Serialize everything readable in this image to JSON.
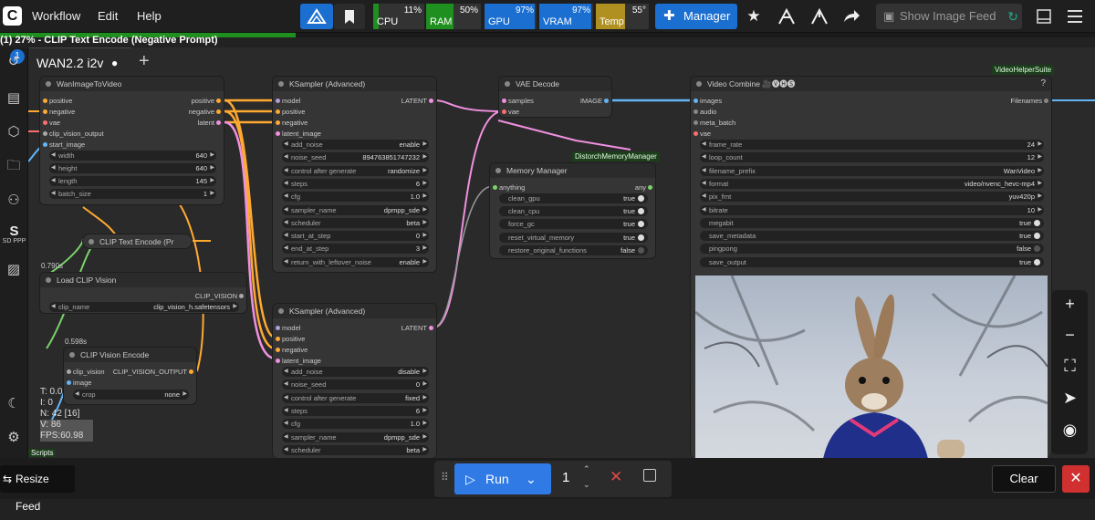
{
  "app": {
    "logo_text": "C"
  },
  "menu": {
    "workflow": "Workflow",
    "edit": "Edit",
    "help": "Help"
  },
  "monitors": {
    "cpu": {
      "label": "CPU",
      "value": "11%",
      "level": 0.11,
      "color": "#1f8f1f"
    },
    "ram": {
      "label": "RAM",
      "value": "50%",
      "level": 0.5,
      "color": "#1f8f1f"
    },
    "gpu": {
      "label": "GPU",
      "value": "97%",
      "level": 0.97,
      "color": "#1a6fd1"
    },
    "vram": {
      "label": "VRAM",
      "value": "97%",
      "level": 0.97,
      "color": "#1a6fd1"
    },
    "temp": {
      "label": "Temp",
      "value": "55°",
      "level": 0.55,
      "color": "#b09020"
    }
  },
  "toolbar": {
    "manager": "Manager",
    "show_image_feed": "Show Image Feed"
  },
  "progress": {
    "status": "(1) 27% - CLIP Text Encode (Negative Prompt)",
    "fraction": 0.27
  },
  "tab": {
    "name": "WAN2.2 i2v",
    "modified": "●",
    "add": "+",
    "queue_badge": "1"
  },
  "sidebar": {
    "sd_label": "SD PPP"
  },
  "stats": {
    "t": "T: 0.0",
    "i": "I: 0",
    "n": "N: 42 [16]",
    "v": "V: 86",
    "fps": "FPS:60.98",
    "scripts": "Scripts"
  },
  "groups": {
    "vhs": "VideoHelperSuite",
    "distorch": "DistorchMemoryManager"
  },
  "nodes": {
    "wan": {
      "title": "WanImageToVideo",
      "inputs": [
        "positive",
        "negative",
        "vae",
        "clip_vision_output",
        "start_image"
      ],
      "outputs": [
        "positive",
        "negative",
        "latent"
      ],
      "widgets": [
        {
          "k": "width",
          "v": "640"
        },
        {
          "k": "height",
          "v": "640"
        },
        {
          "k": "length",
          "v": "145"
        },
        {
          "k": "batch_size",
          "v": "1"
        }
      ]
    },
    "clip_text": {
      "title": "CLIP Text Encode (Pr"
    },
    "load_clip_vision": {
      "title": "Load CLIP Vision",
      "time": "0.790s",
      "output": "CLIP_VISION",
      "widget": {
        "k": "clip_name",
        "v": "clip_vision_h.safetensors"
      }
    },
    "clip_vision_encode": {
      "title": "CLIP Vision Encode",
      "time": "0.598s",
      "inputs": [
        "clip_vision",
        "image"
      ],
      "output": "CLIP_VISION_OUTPUT",
      "widget": {
        "k": "crop",
        "v": "none"
      }
    },
    "ks1": {
      "title": "KSampler (Advanced)",
      "inputs": [
        "model",
        "positive",
        "negative",
        "latent_image"
      ],
      "output": "LATENT",
      "widgets": [
        {
          "k": "add_noise",
          "v": "enable"
        },
        {
          "k": "noise_seed",
          "v": "894763851747232"
        },
        {
          "k": "control after generate",
          "v": "randomize"
        },
        {
          "k": "steps",
          "v": "6"
        },
        {
          "k": "cfg",
          "v": "1.0"
        },
        {
          "k": "sampler_name",
          "v": "dpmpp_sde"
        },
        {
          "k": "scheduler",
          "v": "beta"
        },
        {
          "k": "start_at_step",
          "v": "0"
        },
        {
          "k": "end_at_step",
          "v": "3"
        },
        {
          "k": "return_with_leftover_noise",
          "v": "enable"
        }
      ]
    },
    "ks2": {
      "title": "KSampler (Advanced)",
      "inputs": [
        "model",
        "positive",
        "negative",
        "latent_image"
      ],
      "output": "LATENT",
      "widgets": [
        {
          "k": "add_noise",
          "v": "disable"
        },
        {
          "k": "noise_seed",
          "v": "0"
        },
        {
          "k": "control after generate",
          "v": "fixed"
        },
        {
          "k": "steps",
          "v": "6"
        },
        {
          "k": "cfg",
          "v": "1.0"
        },
        {
          "k": "sampler_name",
          "v": "dpmpp_sde"
        },
        {
          "k": "scheduler",
          "v": "beta"
        }
      ]
    },
    "vae_decode": {
      "title": "VAE Decode",
      "inputs": [
        "samples",
        "vae"
      ],
      "output": "IMAGE"
    },
    "memory": {
      "title": "Memory Manager",
      "input": "anything",
      "output": "any",
      "widgets": [
        {
          "k": "clean_gpu",
          "v": "true"
        },
        {
          "k": "clean_cpu",
          "v": "true"
        },
        {
          "k": "force_gc",
          "v": "true"
        },
        {
          "k": "reset_virtual_memory",
          "v": "true"
        },
        {
          "k": "restore_original_functions",
          "v": "false"
        }
      ]
    },
    "video": {
      "title": "Video Combine",
      "title_badge": "🎥🅥🅗🅢",
      "help": "?",
      "inputs": [
        "images",
        "audio",
        "meta_batch",
        "vae"
      ],
      "output": "Filenames",
      "widgets": [
        {
          "k": "frame_rate",
          "v": "24",
          "kind": "num"
        },
        {
          "k": "loop_count",
          "v": "12",
          "kind": "num"
        },
        {
          "k": "filename_prefix",
          "v": "WanVideo",
          "kind": "text"
        },
        {
          "k": "format",
          "v": "video/nvenc_hevc-mp4",
          "kind": "num"
        },
        {
          "k": "pix_fmt",
          "v": "yuv420p",
          "kind": "num"
        },
        {
          "k": "bitrate",
          "v": "10",
          "kind": "num"
        },
        {
          "k": "megabit",
          "v": "true",
          "kind": "toggle"
        },
        {
          "k": "save_metadata",
          "v": "true",
          "kind": "toggle"
        },
        {
          "k": "pingpong",
          "v": "false",
          "kind": "toggle"
        },
        {
          "k": "save_output",
          "v": "true",
          "kind": "toggle"
        }
      ]
    }
  },
  "bottom": {
    "resize_feed": "Resize Feed",
    "run": "Run",
    "count": "1",
    "clear": "Clear"
  },
  "colors": {
    "accent": "#1a6fd1",
    "run_bg": "#2f7ae5",
    "link_pink": "#f090e0",
    "link_orange": "#ffa931",
    "link_blue": "#64b5f6",
    "link_green": "#7ad36a"
  }
}
